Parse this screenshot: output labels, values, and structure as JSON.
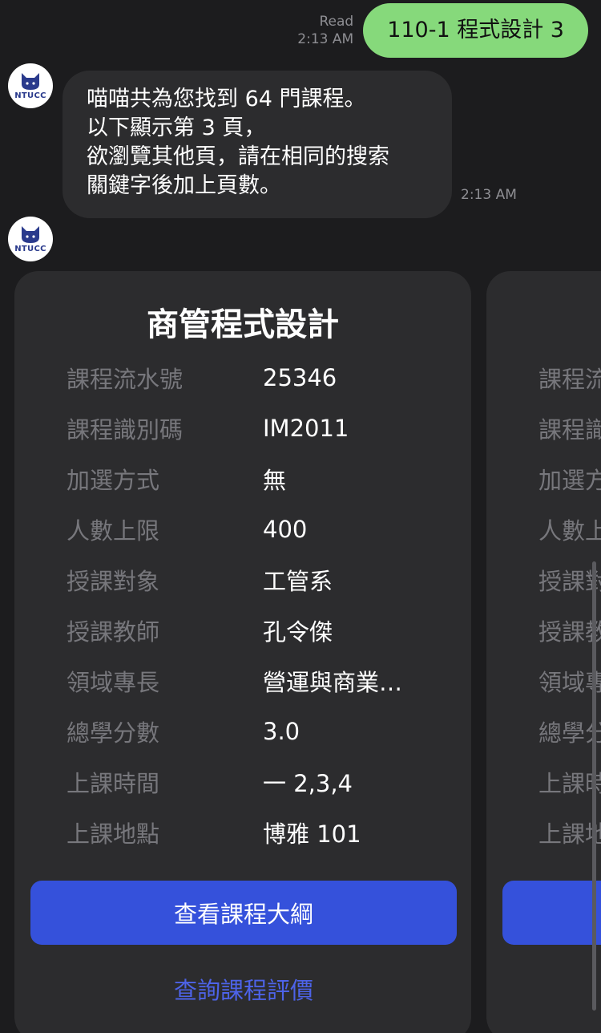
{
  "outgoing": {
    "status": "Read",
    "time": "2:13 AM",
    "text": "110-1 程式設計 3"
  },
  "bot": {
    "avatar_label": "NTUCC",
    "message_lines": [
      "喵喵共為您找到 64 門課程。",
      "以下顯示第 3 頁，",
      "欲瀏覽其他頁，請在相同的搜索",
      "關鍵字後加上頁數。"
    ],
    "time": "2:13 AM"
  },
  "card": {
    "title": "商管程式設計",
    "rows": [
      {
        "label": "課程流水號",
        "value": "25346"
      },
      {
        "label": "課程識別碼",
        "value": "IM2011"
      },
      {
        "label": "加選方式",
        "value": "無"
      },
      {
        "label": "人數上限",
        "value": "400"
      },
      {
        "label": "授課對象",
        "value": "工管系"
      },
      {
        "label": "授課教師",
        "value": "孔令傑"
      },
      {
        "label": "領域專長",
        "value": "營運與商業…"
      },
      {
        "label": "總學分數",
        "value": "3.0"
      },
      {
        "label": "上課時間",
        "value": "一 2,3,4"
      },
      {
        "label": "上課地點",
        "value": "博雅 101"
      }
    ],
    "primary_button": "查看課程大綱",
    "secondary_button": "查詢課程評價"
  },
  "next_card": {
    "labels_partial": [
      "課程流",
      "課程識",
      "加選方",
      "人數上",
      "授課對",
      "授課教",
      "領域專",
      "總學分",
      "上課時",
      "上課地"
    ]
  },
  "colors": {
    "background": "#1c1c1e",
    "bubble_in": "#2c2c2e",
    "bubble_out": "#86d97b",
    "button_primary": "#3551db",
    "link": "#4d63e8",
    "label_gray": "#77777c"
  }
}
